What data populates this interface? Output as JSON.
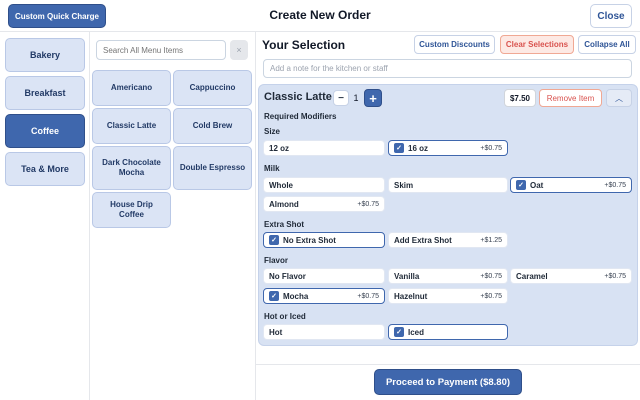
{
  "header": {
    "quick_charge_label": "Custom Quick Charge",
    "title": "Create New Order",
    "close_label": "Close"
  },
  "categories": [
    "Bakery",
    "Breakfast",
    "Coffee",
    "Tea & More"
  ],
  "active_category": "Coffee",
  "search": {
    "placeholder": "Search All Menu Items",
    "clear_icon": "×"
  },
  "menu_items": [
    "Americano",
    "Cappuccino",
    "Classic Latte",
    "Cold Brew",
    "Dark Chocolate Mocha",
    "Double Espresso",
    "House Drip Coffee"
  ],
  "selection": {
    "title": "Your Selection",
    "custom_discounts_label": "Custom Discounts",
    "clear_selections_label": "Clear Selections",
    "collapse_all_label": "Collapse All",
    "note_placeholder": "Add a note for the kitchen or staff"
  },
  "order_item": {
    "name": "Classic Latte",
    "quantity": "1",
    "minus_icon": "−",
    "plus_icon": "+",
    "price": "$7.50",
    "remove_label": "Remove Item",
    "collapse_icon": "︿",
    "required_label": "Required Modifiers",
    "groups": {
      "size": {
        "label": "Size",
        "options": [
          {
            "name": "12 oz",
            "price": "",
            "selected": false
          },
          {
            "name": "16 oz",
            "price": "+$0.75",
            "selected": true
          }
        ]
      },
      "milk": {
        "label": "Milk",
        "options": [
          {
            "name": "Whole",
            "price": "",
            "selected": false
          },
          {
            "name": "Skim",
            "price": "",
            "selected": false
          },
          {
            "name": "Oat",
            "price": "+$0.75",
            "selected": true
          },
          {
            "name": "Almond",
            "price": "+$0.75",
            "selected": false
          }
        ]
      },
      "extra_shot": {
        "label": "Extra Shot",
        "options": [
          {
            "name": "No Extra Shot",
            "price": "",
            "selected": true
          },
          {
            "name": "Add Extra Shot",
            "price": "+$1.25",
            "selected": false
          }
        ]
      },
      "flavor": {
        "label": "Flavor",
        "options": [
          {
            "name": "No Flavor",
            "price": "",
            "selected": false
          },
          {
            "name": "Vanilla",
            "price": "+$0.75",
            "selected": false
          },
          {
            "name": "Caramel",
            "price": "+$0.75",
            "selected": false
          },
          {
            "name": "Mocha",
            "price": "+$0.75",
            "selected": true
          },
          {
            "name": "Hazelnut",
            "price": "+$0.75",
            "selected": false
          }
        ]
      },
      "hot_iced": {
        "label": "Hot or Iced",
        "options": [
          {
            "name": "Hot",
            "price": "",
            "selected": false
          },
          {
            "name": "Iced",
            "price": "",
            "selected": true
          }
        ]
      }
    }
  },
  "payment": {
    "label": "Proceed to Payment ($8.80)"
  },
  "colors": {
    "accent": "#3f67ad",
    "accent_light": "#dbe4f5",
    "danger": "#d9534f"
  }
}
